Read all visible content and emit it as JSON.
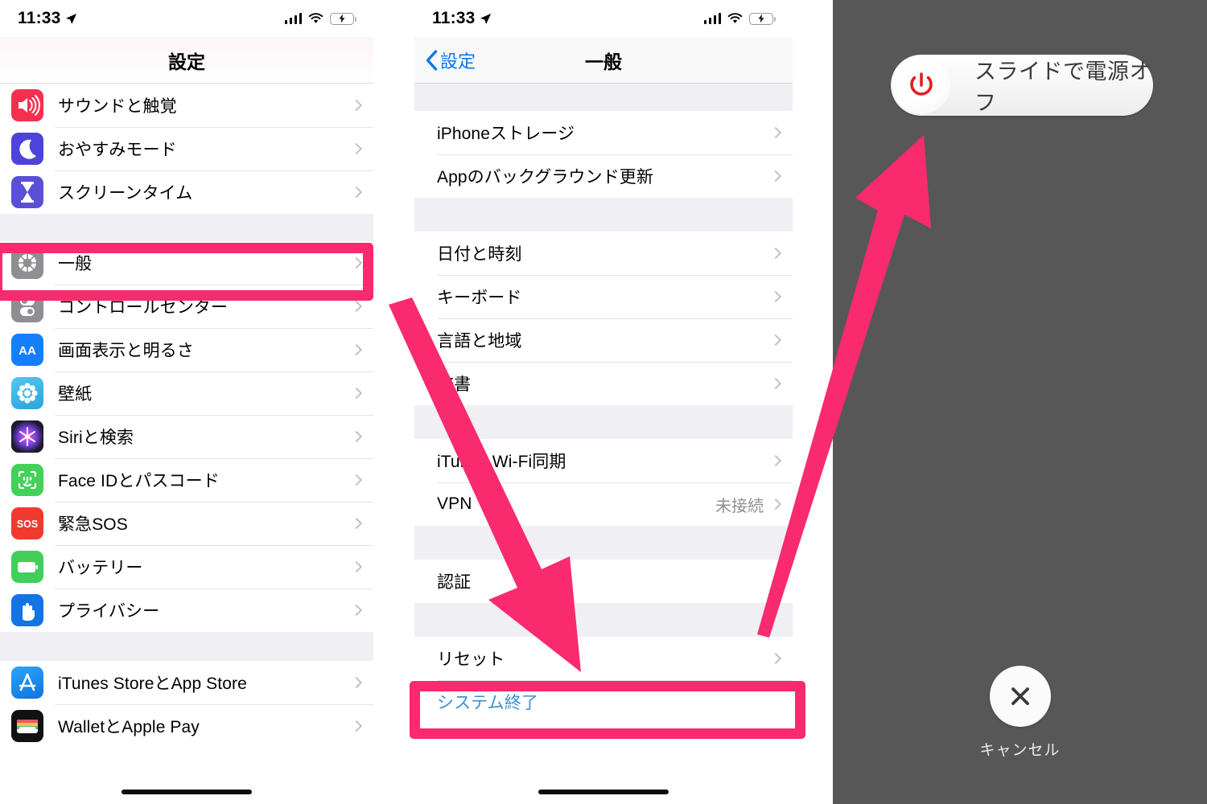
{
  "statusbar": {
    "time": "11:33",
    "location_icon": "location-arrow-icon",
    "signal_icon": "cellular-signal-icon",
    "wifi_icon": "wifi-icon",
    "battery_icon": "battery-charging-icon"
  },
  "panel_settings": {
    "nav_title": "設定",
    "groups": [
      {
        "rows": [
          {
            "label": "サウンドと触覚",
            "icon": "sound-haptics-icon",
            "icon_color": "#F5304F",
            "chevron": true
          },
          {
            "label": "おやすみモード",
            "icon": "do-not-disturb-moon-icon",
            "icon_color": "#4D43D8",
            "chevron": true
          },
          {
            "label": "スクリーンタイム",
            "icon": "screen-time-hourglass-icon",
            "icon_color": "#5A4FD6",
            "chevron": true
          }
        ]
      },
      {
        "rows": [
          {
            "label": "一般",
            "icon": "general-gear-icon",
            "icon_color": "#8E8E93",
            "chevron": true,
            "highlighted": true
          },
          {
            "label": "コントロールセンター",
            "icon": "control-center-toggles-icon",
            "icon_color": "#8E8E93",
            "chevron": true
          },
          {
            "label": "画面表示と明るさ",
            "icon": "display-brightness-aa-icon",
            "icon_color": "#147EFB",
            "chevron": true
          },
          {
            "label": "壁紙",
            "icon": "wallpaper-flower-icon",
            "icon_color": "#3FB7E8",
            "chevron": true
          },
          {
            "label": "Siriと検索",
            "icon": "siri-search-icon",
            "icon_color": "#1B1B2E",
            "chevron": true
          },
          {
            "label": "Face IDとパスコード",
            "icon": "face-id-icon",
            "icon_color": "#42D159",
            "chevron": true
          },
          {
            "label": "緊急SOS",
            "icon": "emergency-sos-icon",
            "icon_color": "#F03A2E",
            "chevron": true
          },
          {
            "label": "バッテリー",
            "icon": "battery-green-icon",
            "icon_color": "#42CE5B",
            "chevron": true
          },
          {
            "label": "プライバシー",
            "icon": "privacy-hand-icon",
            "icon_color": "#1374E4",
            "chevron": true
          }
        ]
      },
      {
        "rows": [
          {
            "label": "iTunes StoreとApp Store",
            "icon": "app-store-icon",
            "icon_color": "#1E8FF0",
            "chevron": true
          },
          {
            "label": "WalletとApple Pay",
            "icon": "wallet-apple-pay-icon",
            "icon_color": "#111111",
            "chevron": true
          }
        ]
      }
    ],
    "highlight_label": "一般"
  },
  "panel_general": {
    "nav_back_label": "設定",
    "nav_back_icon": "chevron-left-icon",
    "nav_title": "一般",
    "groups": [
      {
        "rows": [
          {
            "label": "iPhoneストレージ",
            "chevron": true
          },
          {
            "label": "Appのバックグラウンド更新",
            "chevron": true
          }
        ]
      },
      {
        "rows": [
          {
            "label": "日付と時刻",
            "chevron": true
          },
          {
            "label": "キーボード",
            "chevron": true
          },
          {
            "label": "言語と地域",
            "chevron": true
          },
          {
            "label": "辞書",
            "chevron": true
          }
        ]
      },
      {
        "rows": [
          {
            "label": "iTunes Wi-Fi同期",
            "chevron": true
          },
          {
            "label": "VPN",
            "value": "未接続",
            "chevron": true
          }
        ]
      },
      {
        "rows": [
          {
            "label": "認証",
            "chevron": true
          }
        ]
      },
      {
        "rows": [
          {
            "label": "リセット",
            "chevron": true
          },
          {
            "label": "システム終了",
            "link": true,
            "chevron": false,
            "highlighted": true
          }
        ]
      }
    ],
    "highlight_label": "システム終了"
  },
  "panel_power": {
    "slide_label": "スライドで電源オフ",
    "power_icon": "power-icon",
    "power_icon_color": "#E02020",
    "cancel_label": "キャンセル",
    "cancel_icon": "close-x-icon",
    "background_color": "#575757"
  },
  "annotations": {
    "accent_color": "#fa2a6e",
    "arrow_down_right": "arrow-annotation-icon",
    "arrow_up_right": "arrow-annotation-icon"
  }
}
